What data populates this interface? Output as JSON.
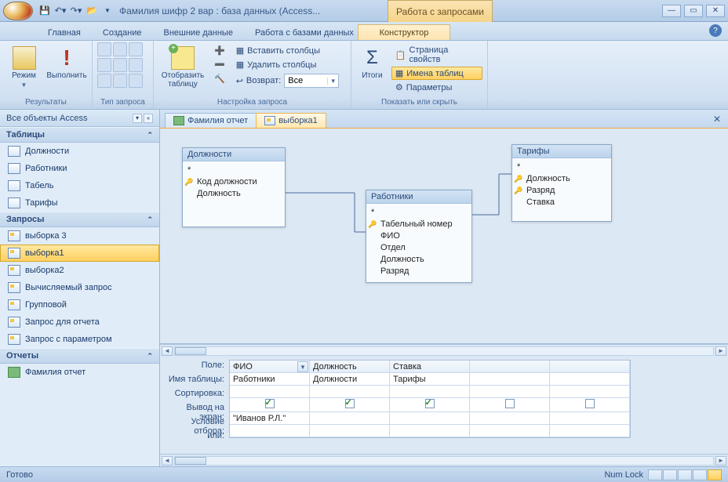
{
  "title": "Фамилия шифр 2 вар : база данных (Access...",
  "context_tab_label": "Работа с запросами",
  "tabs": {
    "home": "Главная",
    "create": "Создание",
    "external": "Внешние данные",
    "dbtools": "Работа с базами данных",
    "designer": "Конструктор"
  },
  "ribbon": {
    "results": {
      "view": "Режим",
      "run": "Выполнить",
      "label": "Результаты"
    },
    "qtype_label": "Тип запроса",
    "showtable": "Отобразить\nтаблицу",
    "insertcols": "Вставить столбцы",
    "deletecols": "Удалить столбцы",
    "return_label": "Возврат:",
    "return_value": "Все",
    "setup_label": "Настройка запроса",
    "totals": "Итоги",
    "propsheet": "Страница свойств",
    "tablenames": "Имена таблиц",
    "params": "Параметры",
    "showhide_label": "Показать или скрыть"
  },
  "nav": {
    "header": "Все объекты Access",
    "groups": {
      "tables": "Таблицы",
      "queries": "Запросы",
      "reports": "Отчеты"
    },
    "tables": [
      "Должности",
      "Работники",
      "Табель",
      "Тарифы"
    ],
    "queries": [
      "выборка 3",
      "выборка1",
      "выборка2",
      "Вычисляемый запрос",
      "Групповой",
      "Запрос для отчета",
      "Запрос с параметром"
    ],
    "reports": [
      "Фамилия отчет"
    ]
  },
  "doc_tabs": {
    "tab1": "Фамилия отчет",
    "tab2": "выборка1"
  },
  "diagram": {
    "t1": {
      "title": "Должности",
      "f_star": "*",
      "f1": "Код должности",
      "f2": "Должность"
    },
    "t2": {
      "title": "Работники",
      "f_star": "*",
      "f1": "Табельный номер",
      "f2": "ФИО",
      "f3": "Отдел",
      "f4": "Должность",
      "f5": "Разряд"
    },
    "t3": {
      "title": "Тарифы",
      "f_star": "*",
      "f1": "Должность",
      "f2": "Разряд",
      "f3": "Ставка"
    }
  },
  "grid": {
    "rows": {
      "field": "Поле:",
      "table": "Имя таблицы:",
      "sort": "Сортировка:",
      "show": "Вывод на экран:",
      "criteria": "Условие отбора:",
      "or": "или:"
    },
    "c1": {
      "field": "ФИО",
      "table": "Работники",
      "criteria": "\"Иванов Р.Л.\""
    },
    "c2": {
      "field": "Должность",
      "table": "Должности"
    },
    "c3": {
      "field": "Ставка",
      "table": "Тарифы"
    }
  },
  "status": {
    "ready": "Готово",
    "numlock": "Num Lock"
  }
}
